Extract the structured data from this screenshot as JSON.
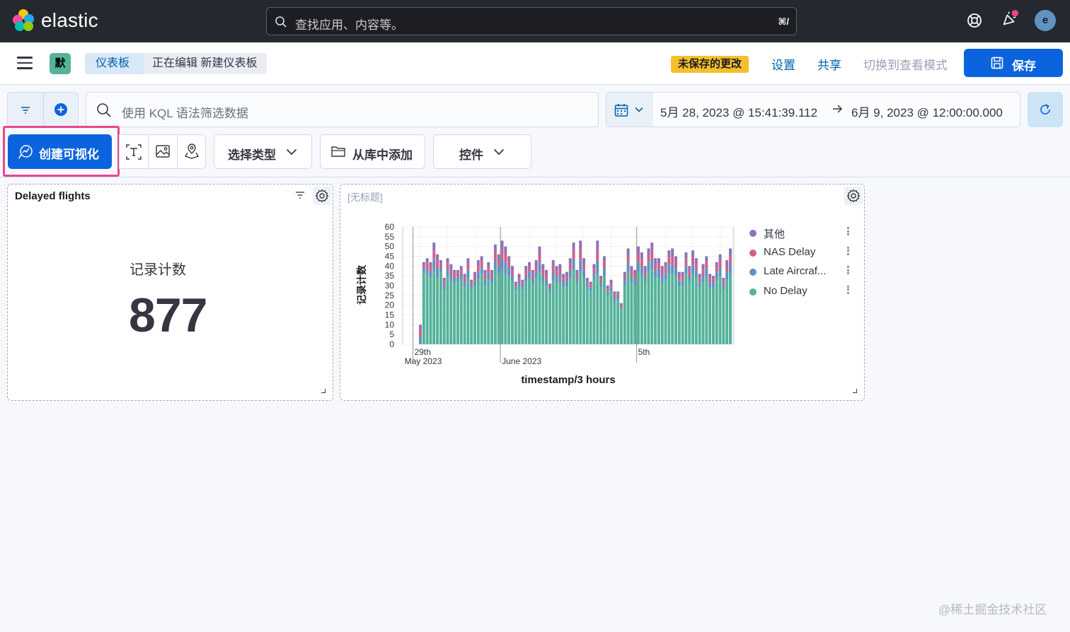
{
  "header": {
    "brand": "elastic",
    "search_placeholder": "查找应用、内容等。",
    "search_shortcut": "⌘/",
    "avatar_initial": "e",
    "colors": {
      "bg": "#25282f",
      "logo": [
        "#f04e98",
        "#fec514",
        "#00bfb3",
        "#1ba9f5",
        "#93c90e",
        "#0b64dd"
      ]
    }
  },
  "navbar": {
    "space_initial": "默",
    "breadcrumbs": [
      "仪表板",
      "正在编辑 新建仪表板"
    ],
    "unsaved_badge": "未保存的更改",
    "settings": "设置",
    "share": "共享",
    "view_mode": "切换到查看模式",
    "save": "保存"
  },
  "query": {
    "kql_placeholder": "使用 KQL 语法筛选数据",
    "start": "5月 28, 2023 @ 15:41:39.112",
    "end": "6月 9, 2023 @ 12:00:00.000"
  },
  "toolbar": {
    "create": "创建可视化",
    "select_type": "选择类型",
    "add_from_library": "从库中添加",
    "controls": "控件",
    "icons": [
      "text-icon",
      "image-icon",
      "map-icon"
    ]
  },
  "panels": {
    "metric": {
      "title": "Delayed flights",
      "label": "记录计数",
      "value": "877"
    },
    "chart_panel": {
      "title": "[无标题]"
    }
  },
  "chart_data": {
    "type": "bar",
    "stacked": true,
    "ylabel": "记录计数",
    "xlabel": "timestamp/3 hours",
    "ylim": [
      0,
      60
    ],
    "yticks": [
      0,
      5,
      10,
      15,
      20,
      25,
      30,
      35,
      40,
      45,
      50,
      55,
      60
    ],
    "xticks": [
      {
        "line1": "29th",
        "line2": "May 2023",
        "bucket": 0
      },
      {
        "line1": "",
        "line2": "June 2023",
        "bucket": 24
      },
      {
        "line1": "5th",
        "line2": "",
        "bucket": 64
      }
    ],
    "gridlines": true,
    "legend_position": "right",
    "series": [
      {
        "name": "No Delay",
        "color": "#54b399"
      },
      {
        "name": "Late Aircraf...",
        "color": "#6092c0"
      },
      {
        "name": "NAS Delay",
        "color": "#d36086"
      },
      {
        "name": "其他",
        "color": "#9170b8"
      }
    ],
    "legend_order": [
      "其他",
      "NAS Delay",
      "Late Aircraf...",
      "No Delay"
    ],
    "totals": [
      10,
      42,
      44,
      42,
      52,
      46,
      43,
      34,
      44,
      41,
      38,
      38,
      40,
      36,
      44,
      33,
      37,
      43,
      45,
      38,
      42,
      38,
      51,
      46,
      53,
      50,
      45,
      40,
      32,
      36,
      33,
      40,
      42,
      38,
      43,
      50,
      41,
      38,
      31,
      43,
      40,
      41,
      36,
      37,
      44,
      52,
      38,
      53,
      44,
      34,
      32,
      41,
      53,
      35,
      45,
      30,
      33,
      27,
      27,
      21,
      37,
      49,
      40,
      38,
      50,
      47,
      40,
      49,
      52,
      44,
      44,
      40,
      42,
      48,
      49,
      45,
      37,
      37,
      47,
      40,
      48,
      44,
      36,
      41,
      45,
      36,
      35,
      42,
      46,
      34,
      43,
      49
    ],
    "no_delay": [
      0,
      37,
      36,
      34,
      38,
      34,
      37,
      28,
      35,
      32,
      31,
      32,
      33,
      29,
      34,
      28,
      30,
      33,
      36,
      30,
      33,
      31,
      38,
      36,
      38,
      36,
      35,
      32,
      28,
      30,
      28,
      32,
      34,
      31,
      34,
      37,
      32,
      30,
      27,
      33,
      31,
      32,
      29,
      30,
      34,
      38,
      31,
      37,
      34,
      29,
      27,
      33,
      36,
      29,
      35,
      25,
      27,
      22,
      23,
      18,
      30,
      37,
      32,
      30,
      37,
      35,
      32,
      37,
      38,
      34,
      34,
      32,
      33,
      36,
      36,
      35,
      30,
      30,
      36,
      32,
      36,
      34,
      29,
      32,
      35,
      29,
      29,
      33,
      35,
      28,
      33,
      36
    ]
  },
  "watermark": "@稀土掘金技术社区"
}
